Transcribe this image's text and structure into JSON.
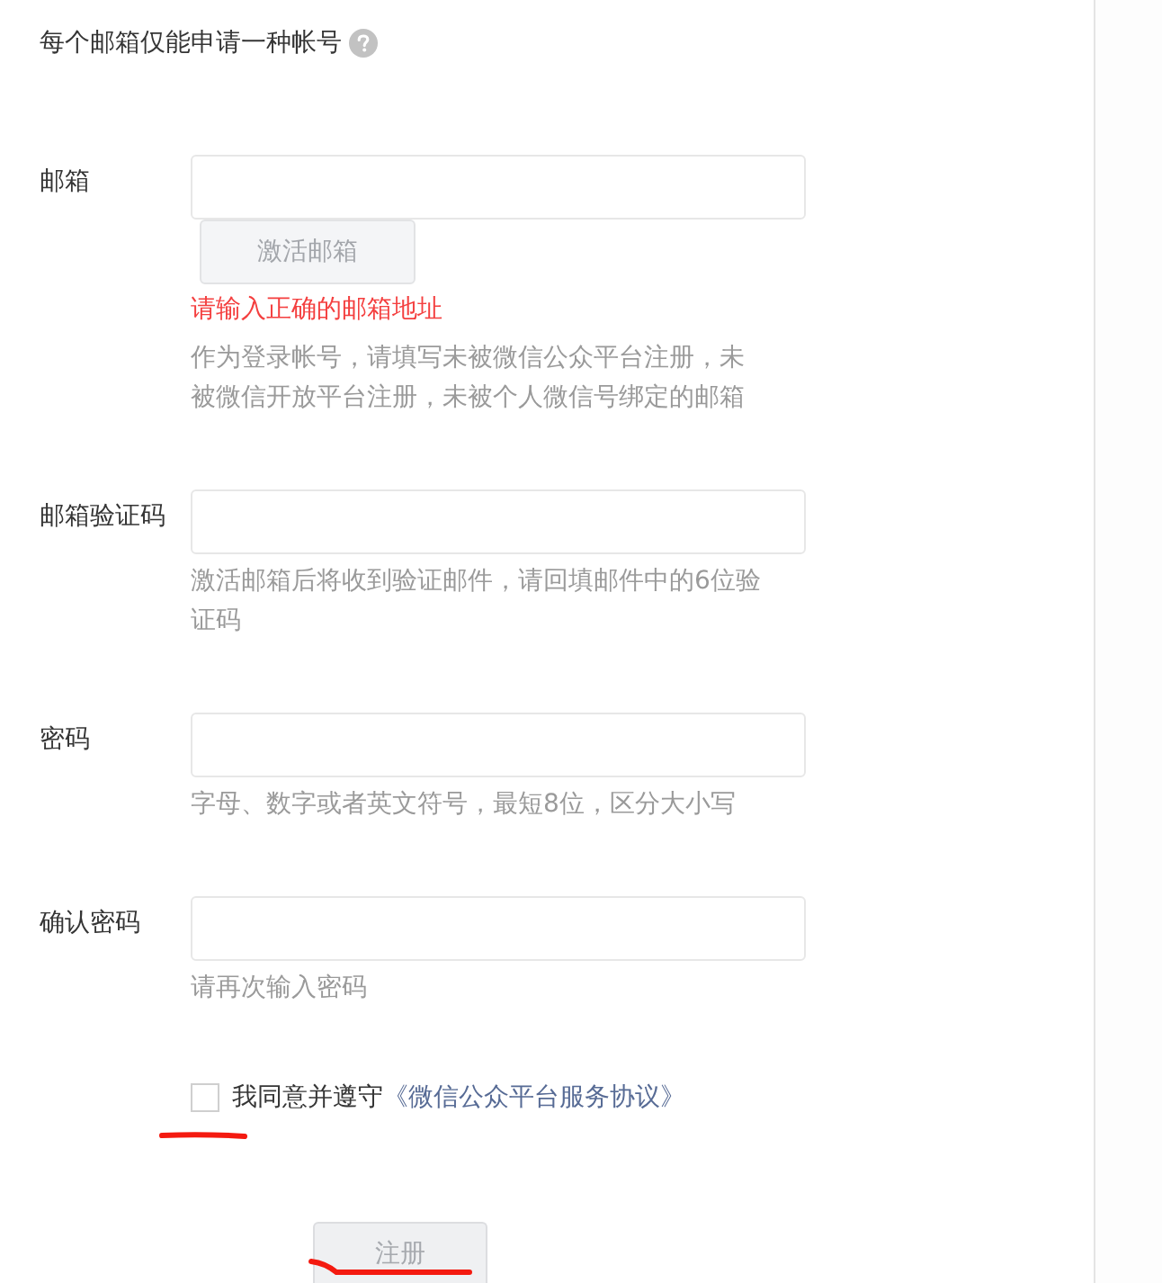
{
  "header": {
    "title": "每个邮箱仅能申请一种帐号"
  },
  "fields": [
    {
      "label": "邮箱",
      "button": {
        "label": "激活邮箱",
        "disabled": true
      },
      "error": "请输入正确的邮箱地址",
      "hint": "作为登录帐号，请填写未被微信公众平台注册，未被微信开放平台注册，未被个人微信号绑定的邮箱"
    },
    {
      "label": "邮箱验证码",
      "hint": "激活邮箱后将收到验证邮件，请回填邮件中的6位验证码"
    },
    {
      "label": "密码",
      "hint": "字母、数字或者英文符号，最短8位，区分大小写"
    },
    {
      "label": "确认密码",
      "hint": "请再次输入密码"
    }
  ],
  "agreement": {
    "checked": false,
    "text": "我同意并遵守",
    "link": "《微信公众平台服务协议》"
  },
  "submit": {
    "label": "注册",
    "disabled": true
  }
}
